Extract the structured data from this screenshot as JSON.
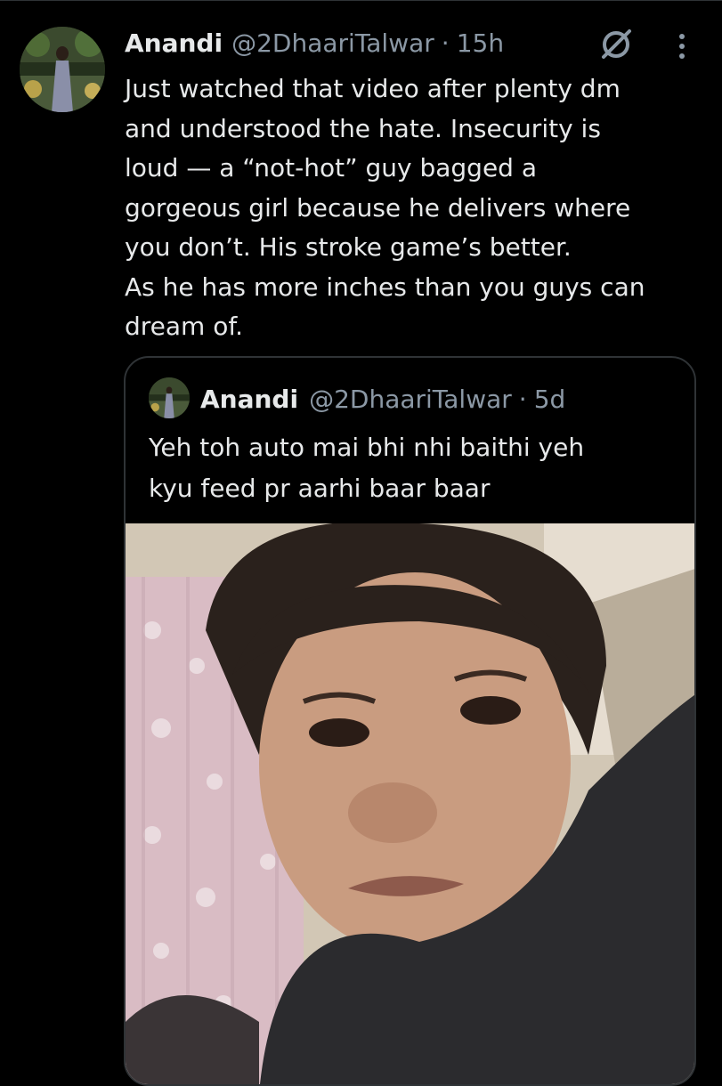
{
  "tweet": {
    "author_name": "Anandi",
    "handle": "@2DhaariTalwar",
    "separator": "·",
    "time": "15h",
    "text": "Just watched that video after plenty dm\nand understood the hate. Insecurity is\nloud — a “not-hot” guy bagged a\ngorgeous girl because he delivers where\nyou don’t. His stroke game’s better.\nAs he has more inches than you guys can\ndream of."
  },
  "quoted_tweet": {
    "author_name": "Anandi",
    "handle": "@2DhaariTalwar",
    "separator": "·",
    "time": "5d",
    "text": "Yeh toh auto mai bhi nhi baithi yeh\nkyu feed pr aarhi baar baar"
  },
  "icons": {
    "grok": "grok-icon",
    "more": "more-options-icon"
  },
  "colors": {
    "background": "#000000",
    "text_primary": "#e7e9ea",
    "text_secondary": "#8b98a5",
    "border": "#2f3336"
  }
}
